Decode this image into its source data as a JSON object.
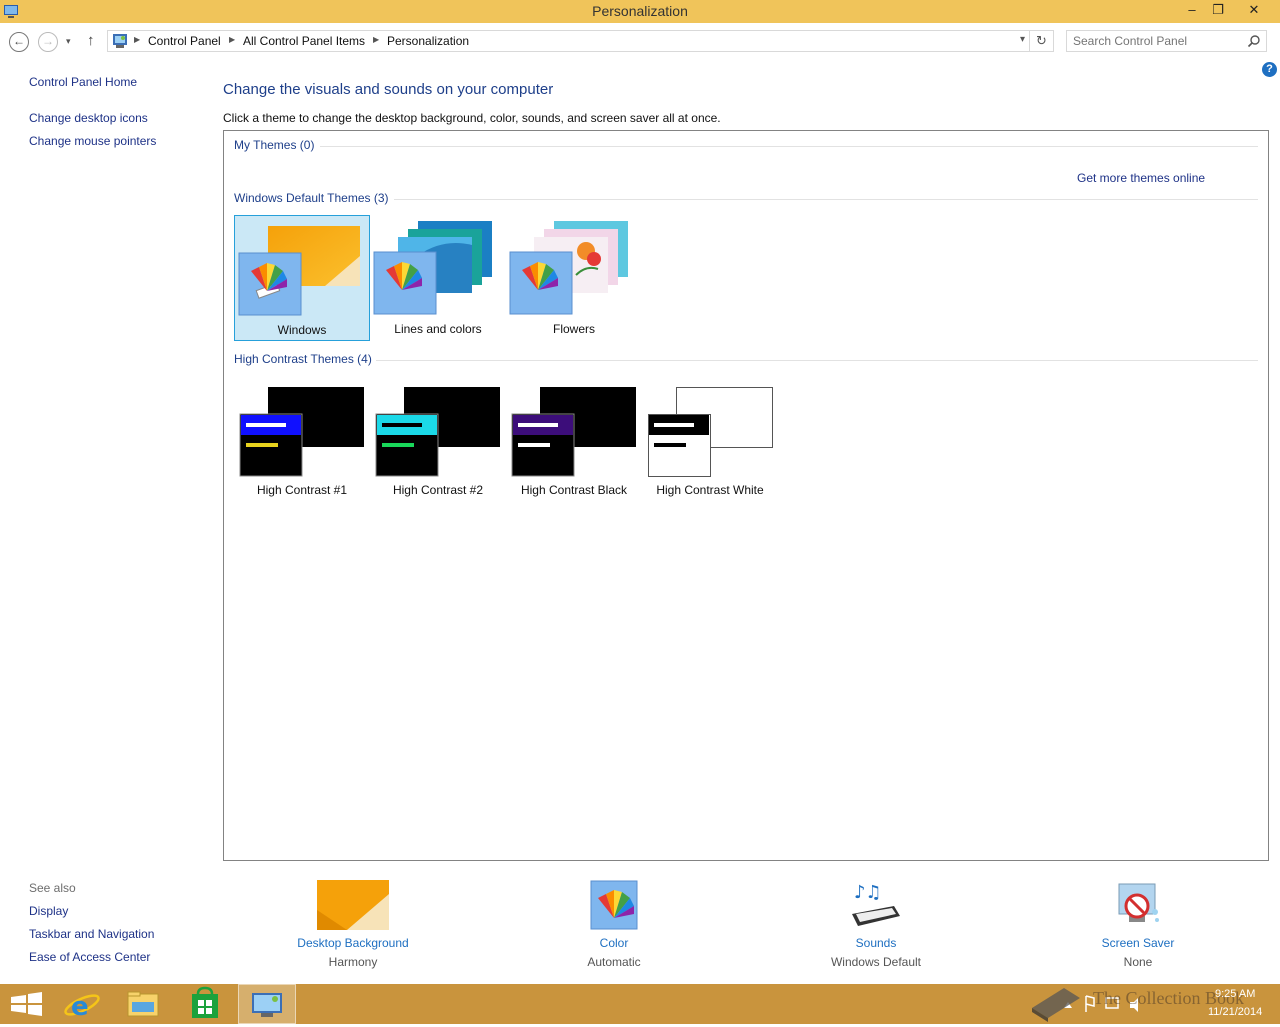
{
  "window": {
    "title": "Personalization",
    "minimize": "–",
    "maximize": "❐",
    "close": "✕"
  },
  "nav": {
    "back": "←",
    "forward": "→",
    "recent": "▾",
    "up": "↑",
    "breadcrumbs": [
      "Control Panel",
      "All Control Panel Items",
      "Personalization"
    ],
    "refresh": "↻",
    "search_placeholder": "Search Control Panel"
  },
  "left_pane": {
    "home": "Control Panel Home",
    "links": [
      "Change desktop icons",
      "Change mouse pointers"
    ],
    "see_also_label": "See also",
    "see_also": [
      "Display",
      "Taskbar and Navigation",
      "Ease of Access Center"
    ]
  },
  "main": {
    "heading": "Change the visuals and sounds on your computer",
    "subheading": "Click a theme to change the desktop background, color, sounds, and screen saver all at once.",
    "help": "?",
    "get_more": "Get more themes online",
    "groups": {
      "my": {
        "title": "My Themes (0)"
      },
      "default": {
        "title": "Windows Default Themes (3)",
        "themes": [
          "Windows",
          "Lines and colors",
          "Flowers"
        ],
        "selected": "Windows"
      },
      "hc": {
        "title": "High Contrast Themes (4)",
        "themes": [
          "High Contrast #1",
          "High Contrast #2",
          "High Contrast Black",
          "High Contrast White"
        ]
      }
    }
  },
  "bottom": {
    "desktop_background": {
      "label": "Desktop Background",
      "value": "Harmony"
    },
    "color": {
      "label": "Color",
      "value": "Automatic"
    },
    "sounds": {
      "label": "Sounds",
      "value": "Windows Default"
    },
    "screen_saver": {
      "label": "Screen Saver",
      "value": "None"
    }
  },
  "taskbar": {
    "watermark": "The Collection Book",
    "time": "9:25 AM",
    "date": "11/21/2014"
  },
  "colors": {
    "titlebar": "#f0c45a",
    "taskbar": "#c9943d",
    "link": "#1e3287",
    "selection": "#cbe8f6"
  }
}
